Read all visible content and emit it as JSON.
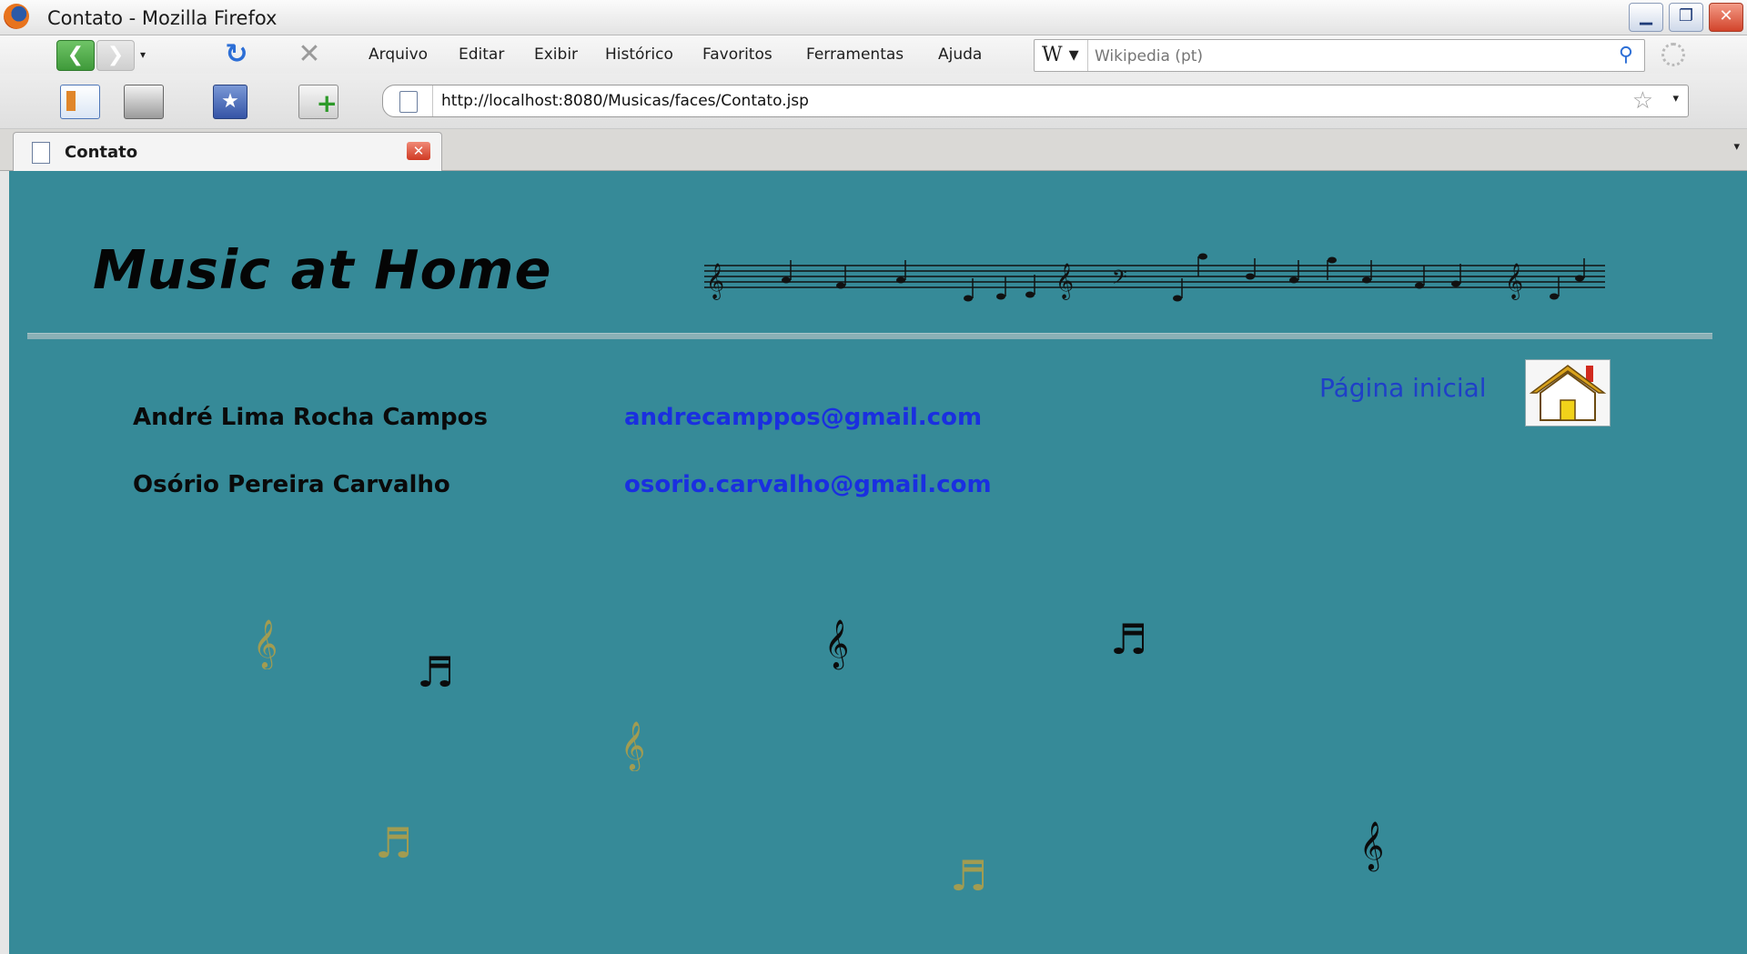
{
  "window": {
    "title": "Contato - Mozilla Firefox",
    "minimize_glyph": "▁",
    "restore_glyph": "❐",
    "close_glyph": "✕"
  },
  "nav": {
    "back_glyph": "❮",
    "forward_glyph": "❯",
    "forward_drop_glyph": "▾",
    "reload_glyph": "↻",
    "stop_glyph": "✕"
  },
  "menu": [
    "Arquivo",
    "Editar",
    "Exibir",
    "Histórico",
    "Favoritos",
    "Ferramentas",
    "Ajuda"
  ],
  "search": {
    "engine_label": "W ▾",
    "placeholder": "Wikipedia (pt)",
    "icon": "search-icon"
  },
  "toolbar": {
    "bookmark_glyph": "★",
    "newtab_glyph": "+"
  },
  "url": {
    "value": "http://localhost:8080/Musicas/faces/Contato.jsp",
    "star_glyph": "☆",
    "drop_glyph": "▾"
  },
  "tabs": {
    "active_label": "Contato",
    "close_glyph": "✕",
    "list_glyph": "▾"
  },
  "page": {
    "site_title": "Music at Home",
    "home_link": "Página inicial",
    "contacts": [
      {
        "name": "André Lima Rocha Campos",
        "email": "andrecamppos@gmail.com"
      },
      {
        "name": "Osório Pereira Carvalho",
        "email": "osorio.carvalho@gmail.com"
      }
    ],
    "decor_notes": [
      {
        "glyph": "𝄞",
        "tone": "gold"
      },
      {
        "glyph": "♬",
        "tone": "black"
      },
      {
        "glyph": "𝄞",
        "tone": "black"
      },
      {
        "glyph": "♬",
        "tone": "black"
      },
      {
        "glyph": "𝄞",
        "tone": "gold"
      },
      {
        "glyph": "♬",
        "tone": "gold"
      },
      {
        "glyph": "♬",
        "tone": "gold"
      },
      {
        "glyph": "𝄞",
        "tone": "black"
      }
    ],
    "colors": {
      "background": "#368a98",
      "link": "#1a2fe0",
      "home_link": "#1f3fc8"
    }
  }
}
